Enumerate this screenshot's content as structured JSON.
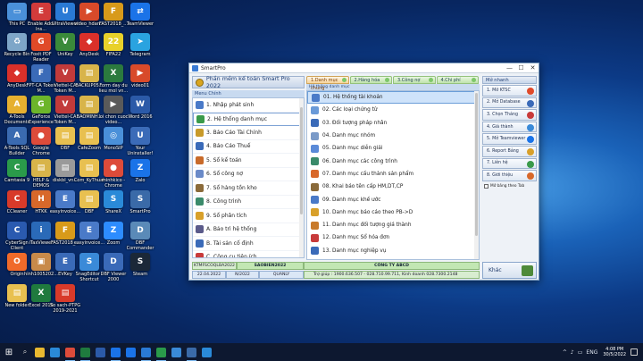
{
  "desktop": {
    "icons": [
      {
        "label": "This PC",
        "color": "#4a90d9",
        "glyph": "▭"
      },
      {
        "label": "Enable Add-Ins...",
        "color": "#d23b3b",
        "glyph": "E"
      },
      {
        "label": "UltraViewer",
        "color": "#2a7ad5",
        "glyph": "U"
      },
      {
        "label": "video_hdan...",
        "color": "#d84a2a",
        "glyph": "▶"
      },
      {
        "label": "FAST2018_...",
        "color": "#d89a1a",
        "glyph": "F"
      },
      {
        "label": "TeamViewer",
        "color": "#1a73e8",
        "glyph": "⇄"
      },
      {
        "label": "Recycle Bin",
        "color": "#7ea6c8",
        "glyph": "♻"
      },
      {
        "label": "Foxit PDF Reader",
        "color": "#e04a28",
        "glyph": "G"
      },
      {
        "label": "UniKey",
        "color": "#3a8a3a",
        "glyph": "V"
      },
      {
        "label": "AnyDesk",
        "color": "#d9302a",
        "glyph": "◆"
      },
      {
        "label": "FIFA22",
        "color": "#e8d12a",
        "glyph": "22"
      },
      {
        "label": "Telegram",
        "color": "#2aa3e0",
        "glyph": "➤"
      },
      {
        "label": "AnyDesk",
        "color": "#d9302a",
        "glyph": "◆"
      },
      {
        "label": "FPT-CA Token M...",
        "color": "#3b6bb8",
        "glyph": "F"
      },
      {
        "label": "Viettel-CA Token M...",
        "color": "#c23a3a",
        "glyph": "V"
      },
      {
        "label": "BACKUP05...",
        "color": "#d8b44a",
        "glyph": "▤"
      },
      {
        "label": "Form day du lieu mol vn...",
        "color": "#2b7a3e",
        "glyph": "X"
      },
      {
        "label": "video01",
        "color": "#d84a2a",
        "glyph": "▶"
      },
      {
        "label": "A-Tools Documents",
        "color": "#e6b030",
        "glyph": "A"
      },
      {
        "label": "GeForce Experience",
        "color": "#6cb52a",
        "glyph": "G"
      },
      {
        "label": "Viettel-CA Token M...",
        "color": "#c23a3a",
        "glyph": "V"
      },
      {
        "label": "BAOMINH...",
        "color": "#d8b44a",
        "glyph": "▤"
      },
      {
        "label": "loi chon cuoc video...",
        "color": "#5a5a5a",
        "glyph": "▶"
      },
      {
        "label": "Word 2016",
        "color": "#2b5aa8",
        "glyph": "W"
      },
      {
        "label": "A-Tools SQL Builder",
        "color": "#3a6ab0",
        "glyph": "A"
      },
      {
        "label": "Google Chrome",
        "color": "#dd4b3a",
        "glyph": "●"
      },
      {
        "label": "DBF",
        "color": "#e8c050",
        "glyph": "▤"
      },
      {
        "label": "CafeZoom",
        "color": "#e8c050",
        "glyph": "▤"
      },
      {
        "label": "MonoSIP",
        "color": "#4a90d9",
        "glyph": "◎"
      },
      {
        "label": "Your Uninstaller!",
        "color": "#3b6bb8",
        "glyph": "U"
      },
      {
        "label": "Camtasia 9",
        "color": "#2a9a4a",
        "glyph": "C"
      },
      {
        "label": "HELP & DEMOS",
        "color": "#d8b44a",
        "glyph": "▤"
      },
      {
        "label": "diskbl_vn...",
        "color": "#9a9a9a",
        "glyph": "▤"
      },
      {
        "label": "Com_KyThuat",
        "color": "#e8c050",
        "glyph": "▤"
      },
      {
        "label": "minhkico - Chrome",
        "color": "#dd4b3a",
        "glyph": "●"
      },
      {
        "label": "Zalo",
        "color": "#1a73e8",
        "glyph": "Z"
      },
      {
        "label": "CCleaner",
        "color": "#d83a2a",
        "glyph": "C"
      },
      {
        "label": "HTKK",
        "color": "#d8682a",
        "glyph": "H"
      },
      {
        "label": "easyinvoice...",
        "color": "#4a7ac8",
        "glyph": "E"
      },
      {
        "label": "DBF",
        "color": "#e8c050",
        "glyph": "▤"
      },
      {
        "label": "ShareX",
        "color": "#2a8ad8",
        "glyph": "S"
      },
      {
        "label": "SmartPro",
        "color": "#3a6aa8",
        "glyph": "S"
      },
      {
        "label": "CyberSign Client",
        "color": "#2a5ab0",
        "glyph": "C"
      },
      {
        "label": "iTaxViewer",
        "color": "#2a6ab8",
        "glyph": "i"
      },
      {
        "label": "FAST2018_...",
        "color": "#d89a1a",
        "glyph": "F"
      },
      {
        "label": "easyinvoice...",
        "color": "#4a7ac8",
        "glyph": "E"
      },
      {
        "label": "Zoom",
        "color": "#2d8cff",
        "glyph": "Z"
      },
      {
        "label": "DBF Commander",
        "color": "#5a8ab8",
        "glyph": "D"
      },
      {
        "label": "Origin",
        "color": "#f06a2a",
        "glyph": "O"
      },
      {
        "label": "hinh1005202...",
        "color": "#c88a4a",
        "glyph": "▣"
      },
      {
        "label": "EVKey",
        "color": "#3a6ab8",
        "glyph": "E"
      },
      {
        "label": "SnagEditor - Shortcut",
        "color": "#3a8ad8",
        "glyph": "S"
      },
      {
        "label": "DBF Viewer 2000",
        "color": "#3a6ab8",
        "glyph": "D"
      },
      {
        "label": "Steam",
        "color": "#1b2838",
        "glyph": "S"
      },
      {
        "label": "New folder",
        "color": "#e8c050",
        "glyph": "▤"
      },
      {
        "label": "Excel 2016",
        "color": "#1f7a3e",
        "glyph": "X"
      },
      {
        "label": "So sach-PTPG 2019-2021",
        "color": "#d83a2a",
        "glyph": "▤"
      }
    ]
  },
  "window": {
    "title": "SmartPro",
    "minimize": "—",
    "maximize": "☐",
    "close": "✕",
    "app_header": "Phần mềm kế toán Smart Pro 2022",
    "menu_heading": "Menu Chính",
    "menu_items": [
      {
        "label": "1. Nhập phát sinh",
        "color": "#4a7ac8"
      },
      {
        "label": "2. Hệ thống danh mục",
        "color": "#3a9a4a"
      },
      {
        "label": "3. Báo Cáo Tài Chính",
        "color": "#c89a2a"
      },
      {
        "label": "4. Báo Cáo Thuế",
        "color": "#3a6ab8"
      },
      {
        "label": "5. Sổ kế toán",
        "color": "#c86a2a"
      },
      {
        "label": "6. Sổ công nợ",
        "color": "#6a8ac8"
      },
      {
        "label": "7. Sổ hàng tồn kho",
        "color": "#8a6a3a"
      },
      {
        "label": "8. Công trình",
        "color": "#3a8a6a"
      },
      {
        "label": "9. Sổ phân tích",
        "color": "#d8a02a"
      },
      {
        "label": "A. Bảo trì hệ thống",
        "color": "#5a5a8a"
      },
      {
        "label": "B. Tài sản cố định",
        "color": "#3a6ab8"
      },
      {
        "label": "C. Công cụ tiện ích",
        "color": "#c83a3a"
      },
      {
        "label": "D. Phân quyền",
        "color": "#d8a02a"
      }
    ],
    "tabs": [
      {
        "label": "1.Danh mục chung"
      },
      {
        "label": "2.Hàng hóa"
      },
      {
        "label": "3.Công nợ"
      },
      {
        "label": "4.Chi phí"
      }
    ],
    "catalog_heading": "Hệ thống danh mục",
    "catalog_items": [
      {
        "label": "01. Hệ thống tài khoản",
        "color": "#4a7ac8"
      },
      {
        "label": "02. Các loại chứng từ",
        "color": "#6a9ad8"
      },
      {
        "label": "03. Đối tượng pháp nhân",
        "color": "#3a6ab8"
      },
      {
        "label": "04. Danh mục nhóm",
        "color": "#7a9ac8"
      },
      {
        "label": "05. Danh mục diễn giải",
        "color": "#5a8ad8"
      },
      {
        "label": "06. Danh mục các công trình",
        "color": "#3a8a6a"
      },
      {
        "label": "07. Danh mục cấu thành sản phẩm",
        "color": "#d8682a"
      },
      {
        "label": "08. Khai báo tên cấp HM,DT,CP",
        "color": "#8a6a3a"
      },
      {
        "label": "09. Danh mục khế ước",
        "color": "#4a7ac8"
      },
      {
        "label": "10. Danh mục báo cáo theo PB->D",
        "color": "#d8a02a"
      },
      {
        "label": "11. Danh mục đối tượng giá thành",
        "color": "#c87a2a"
      },
      {
        "label": "12. Danh mục Sổ hóa đơn",
        "color": "#c83a3a"
      },
      {
        "label": "13. Danh mục nghiệp vụ",
        "color": "#3a6ab8"
      }
    ],
    "quick_heading": "Mở nhanh",
    "quick_buttons": [
      {
        "label": "1. Mở KTSC",
        "color": "#e04a2a"
      },
      {
        "label": "2. Mở Database",
        "color": "#3a6ab8"
      },
      {
        "label": "3. Chọn Tháng",
        "color": "#c83a3a"
      },
      {
        "label": "4. Giá thành",
        "color": "#3a8ad8"
      },
      {
        "label": "5. Mở Teamviewer",
        "color": "#1a73e8"
      },
      {
        "label": "6. Report Bảng",
        "color": "#d8a02a"
      },
      {
        "label": "7. Liên hệ",
        "color": "#3a9a4a"
      },
      {
        "label": "8. Giới thiệu",
        "color": "#d8682a"
      }
    ],
    "checkbox_label": "Mở bảng theo Tab",
    "status": {
      "a": "KTMFSCOQLBA2022",
      "b": "SAOBIEN2022",
      "company": "CÔNG TY ABCD",
      "date": "22.04.2022",
      "period": "N/2022",
      "user": "QUANLY",
      "support": "Trợ giúp : 1900.636.507 - 028.710.99.711, Kinh doanh 028.7300.2148"
    },
    "exit_label": "Khác"
  },
  "taskbar": {
    "start": "⊞",
    "search": "⌕",
    "apps": [
      {
        "name": "file-explorer",
        "color": "#e8b830",
        "running": false
      },
      {
        "name": "edge",
        "color": "#2a8ad8",
        "running": false
      },
      {
        "name": "chrome",
        "color": "#dd4b3a",
        "running": true
      },
      {
        "name": "excel",
        "color": "#1f7a3e",
        "running": true
      },
      {
        "name": "word",
        "color": "#2b5aa8",
        "running": false
      },
      {
        "name": "zalo",
        "color": "#1a73e8",
        "running": true
      },
      {
        "name": "teamviewer",
        "color": "#1a73e8",
        "running": false
      },
      {
        "name": "ultraviewer",
        "color": "#2a7ad5",
        "running": true
      },
      {
        "name": "camtasia",
        "color": "#2a9a4a",
        "running": true
      },
      {
        "name": "snagit",
        "color": "#3a8ad8",
        "running": false
      },
      {
        "name": "smartpro",
        "color": "#3a6aa8",
        "running": true
      },
      {
        "name": "sharex",
        "color": "#2a8ad8",
        "running": false
      }
    ],
    "tray_icons": [
      "^",
      "♪",
      "▭",
      "ENG"
    ],
    "time": "4:08 PM",
    "date": "30/5/2022"
  }
}
